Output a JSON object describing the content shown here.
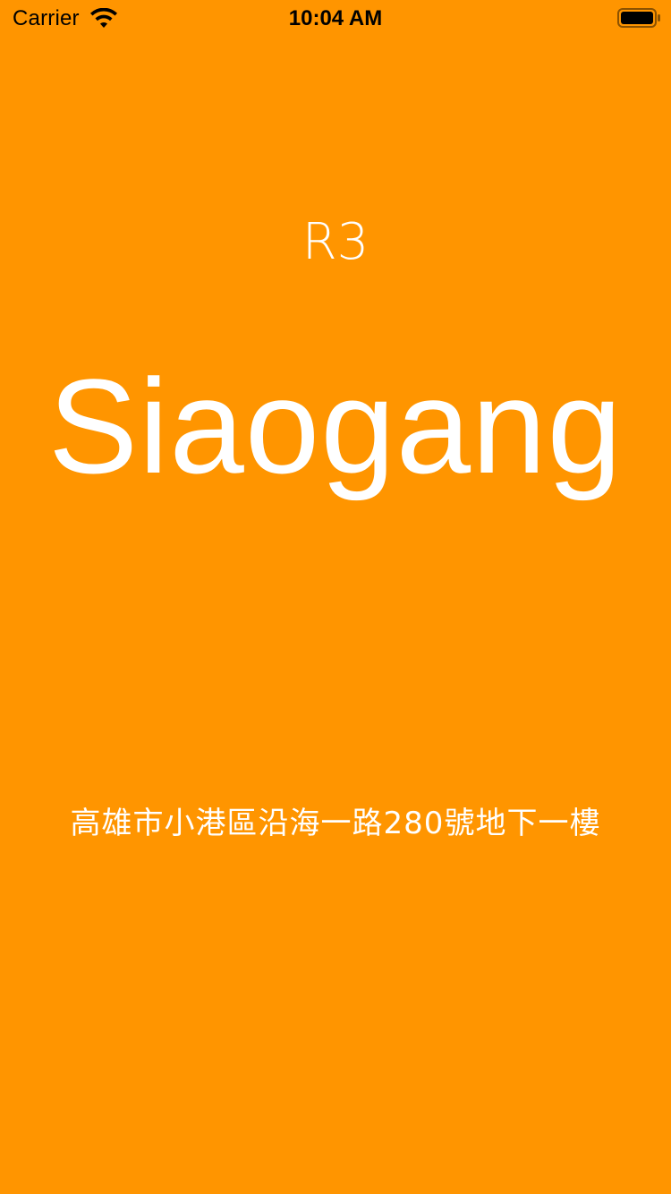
{
  "status_bar": {
    "carrier": "Carrier",
    "time": "10:04 AM",
    "icons": [
      "wifi-icon",
      "battery-icon"
    ]
  },
  "station": {
    "code": "R3",
    "name": "Siaogang",
    "address": "高雄市小港區沿海一路280號地下一樓"
  },
  "colors": {
    "background": "#FF9500",
    "text": "#FFFFFF",
    "status_text": "#000000"
  }
}
